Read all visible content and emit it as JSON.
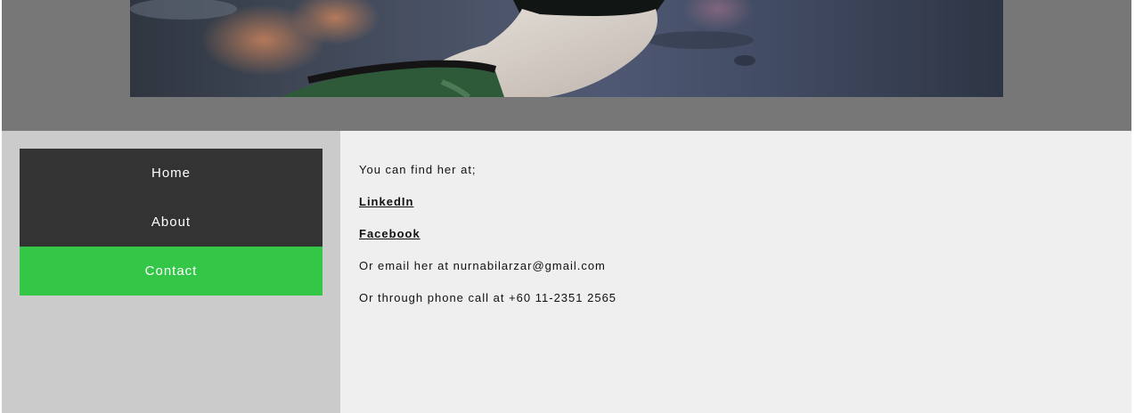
{
  "nav": {
    "items": [
      {
        "label": "Home",
        "active": false
      },
      {
        "label": "About",
        "active": false
      },
      {
        "label": "Contact",
        "active": true
      }
    ]
  },
  "contact": {
    "intro": "You can find her at;",
    "linkedin_label": "LinkedIn",
    "facebook_label": "Facebook",
    "email_text": "Or email her at nurnabilarzar@gmail.com",
    "phone_text": "Or through phone call at +60 11-2351 2565"
  },
  "colors": {
    "header_bg": "#777777",
    "sidebar_bg": "#cbcbcb",
    "nav_bg": "#333333",
    "nav_active_bg": "#34c646",
    "content_bg": "#efefef"
  }
}
